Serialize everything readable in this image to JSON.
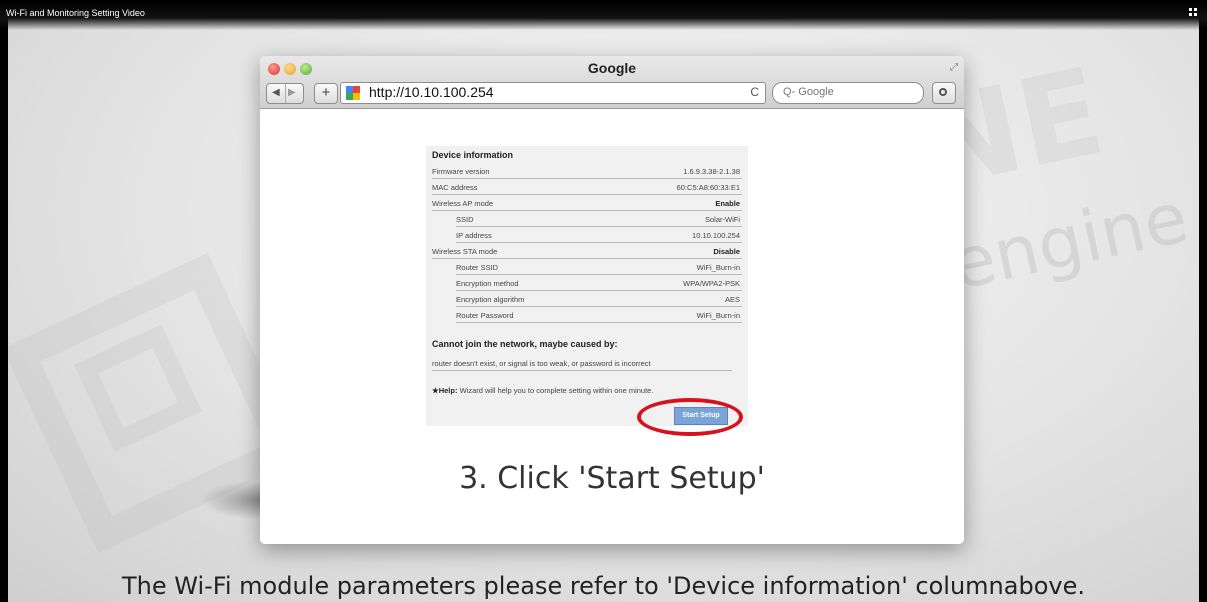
{
  "video": {
    "title": "Wi-Fi and Monitoring Setting Video",
    "watermark": "engine"
  },
  "browser": {
    "window_title": "Google",
    "url": "http://10.10.100.254",
    "search_placeholder": "Q- Google",
    "add_label": "+",
    "reload_icon": "reload-icon",
    "back_icon": "◀",
    "forward_icon": "▶",
    "reload_glyph": "C"
  },
  "device": {
    "title": "Device information",
    "rows": [
      {
        "label": "Firmware version",
        "value": "1.6.9.3.38-2.1.38",
        "indent": false,
        "bold": false
      },
      {
        "label": "MAC address",
        "value": "60:C5:A8:60:33:E1",
        "indent": false,
        "bold": false
      },
      {
        "label": "Wireless AP mode",
        "value": "Enable",
        "indent": false,
        "bold": true
      },
      {
        "label": "SSID",
        "value": "Solar-WiFi",
        "indent": true,
        "bold": false
      },
      {
        "label": "IP address",
        "value": "10.10.100.254",
        "indent": true,
        "bold": false
      },
      {
        "label": "Wireless STA mode",
        "value": "Disable",
        "indent": false,
        "bold": true
      },
      {
        "label": "Router SSID",
        "value": "WiFi_Burn-in",
        "indent": true,
        "bold": false
      },
      {
        "label": "Encryption method",
        "value": "WPA/WPA2-PSK",
        "indent": true,
        "bold": false
      },
      {
        "label": "Encryption algorithm",
        "value": "AES",
        "indent": true,
        "bold": false
      },
      {
        "label": "Router Password",
        "value": "WiFi_Burn-in",
        "indent": true,
        "bold": false
      }
    ],
    "cannot_join": "Cannot join the network, maybe caused by:",
    "reason": "router doesn't exist, or signal is too weak, or password is incorrect",
    "help_label": "★Help:",
    "help_text": "Wizard will help you to complete setting within one minute.",
    "start_button": "Start Setup"
  },
  "step_caption": "3. Click 'Start Setup'",
  "subtitle": "The Wi-Fi module parameters please refer to 'Device information' columnabove.",
  "colors": {
    "highlight": "#d8121d",
    "button": "#7aa4d8"
  }
}
